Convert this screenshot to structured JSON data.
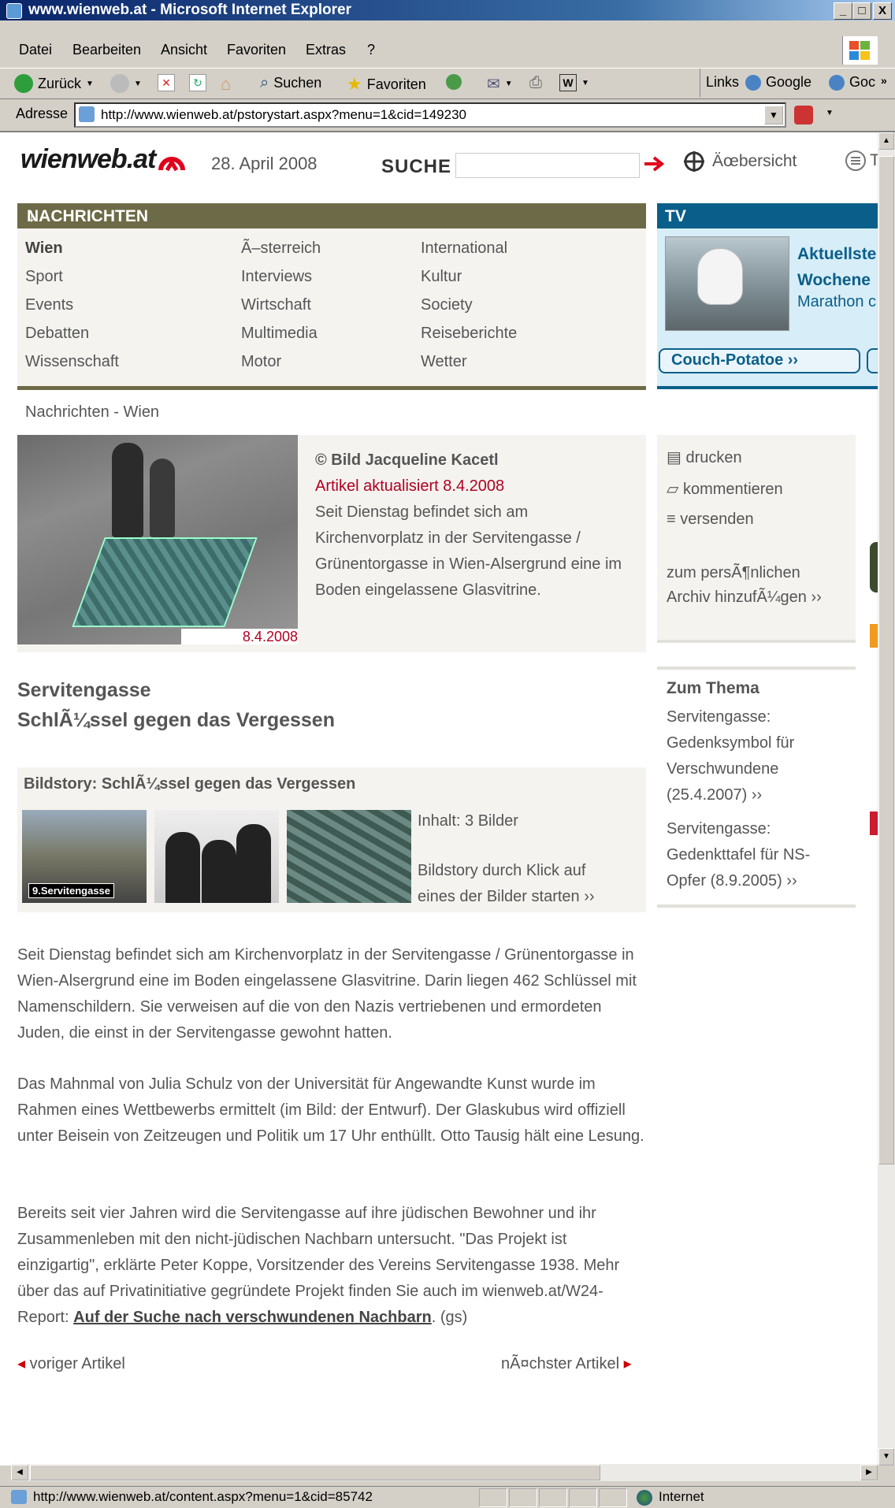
{
  "window": {
    "title": "www.wienweb.at - Microsoft Internet Explorer",
    "min_glyph": "_",
    "max_glyph": "□",
    "close_glyph": "X"
  },
  "menu": [
    "Datei",
    "Bearbeiten",
    "Ansicht",
    "Favoriten",
    "Extras",
    "?"
  ],
  "toolbar": {
    "back": "Zurück",
    "search": "Suchen",
    "favorites": "Favoriten",
    "links": "Links",
    "google1": "Google",
    "google2": "Goc"
  },
  "address": {
    "label": "Adresse",
    "url": "http://www.wienweb.at/pstorystart.aspx?menu=1&cid=149230"
  },
  "site": {
    "logo": "wienweb.at",
    "date": "28. April 2008",
    "search_label": "SUCHE",
    "overview": "Äœbersicht",
    "t_link": "T"
  },
  "nachrichten": {
    "header": "NACHRICHTEN",
    "col1": [
      "Wien",
      "Sport",
      "Events",
      "Debatten",
      "Wissenschaft"
    ],
    "col2": [
      "Ã–sterreich",
      "Interviews",
      "Wirtschaft",
      "Multimedia",
      "Motor"
    ],
    "col3": [
      "International",
      "Kultur",
      "Society",
      "Reiseberichte",
      "Wetter"
    ]
  },
  "tv": {
    "header": "TV",
    "title_line1": "Aktuellste",
    "title_line2": "Wochene",
    "subtitle": "Marathon c",
    "button": "Couch-Potatoe ››"
  },
  "breadcrumb": "Nachrichten - Wien",
  "article": {
    "image_date": "8.4.2008",
    "credit": "© Bild Jacqueline Kacetl",
    "updated": "Artikel aktualisiert 8.4.2008",
    "teaser": "Seit Dienstag befindet sich am Kirchenvorplatz in der Servitengasse / Grünentorgasse in Wien-Alsergrund eine im Boden eingelassene Glasvitrine.",
    "headline1": "Servitengasse",
    "headline2": "SchlÃ¼ssel gegen das Vergessen"
  },
  "bildstory": {
    "title": "Bildstory: SchlÃ¼ssel gegen das Vergessen",
    "thumb1_label": "9.Servitengasse",
    "count": "Inhalt: 3 Bilder",
    "hint_line1": "Bildstory durch Klick auf",
    "hint_line2": "eines der Bilder starten ››"
  },
  "body": {
    "p1": "Seit Dienstag befindet sich am Kirchenvorplatz in der Servitengasse / Grünentorgasse in Wien-Alsergrund eine im Boden eingelassene Glasvitrine. Darin liegen 462 Schlüssel mit Namenschildern. Sie verweisen auf die von den Nazis vertriebenen und ermordeten Juden, die einst in der Servitengasse gewohnt hatten.",
    "p2": "Das Mahnmal von Julia Schulz von der Universität für Angewandte Kunst wurde im Rahmen eines Wettbewerbs ermittelt (im Bild: der Entwurf). Der Glaskubus wird offiziell unter Beisein von Zeitzeugen und Politik um 17 Uhr enthüllt. Otto Tausig hält eine Lesung.",
    "p3_text": "Bereits seit vier Jahren wird die Servitengasse auf ihre jüdischen Bewohner und ihr Zusammenleben mit den nicht-jüdischen Nachbarn untersucht. \"Das Projekt ist einzigartig\", erklärte Peter Koppe, Vorsitzender des Vereins Servitengasse 1938. Mehr über das auf Privatinitiative gegründete Projekt finden Sie auch im wienweb.at/W24-Report: ",
    "p3_link": "Auf der Suche nach verschwundenen Nachbarn",
    "p3_end": ". (gs)"
  },
  "pager": {
    "prev": "voriger Artikel",
    "next": "nÃ¤chster Artikel"
  },
  "tools": {
    "print": "drucken",
    "comment": "kommentieren",
    "send": "versenden",
    "archive_line1": "zum persÃ¶nlichen",
    "archive_line2": "Archiv hinzufÃ¼gen ››"
  },
  "zum_thema": {
    "title": "Zum Thema",
    "item1": "Servitengasse: Gedenksymbol für Verschwundene (25.4.2007) ››",
    "item2": "Servitengasse: Gedenkttafel für NS-Opfer (8.9.2005) ››"
  },
  "status": {
    "url": "http://www.wienweb.at/content.aspx?menu=1&cid=85742",
    "zone": "Internet"
  },
  "colors": {
    "titlebar": "#0a246a",
    "nav_header": "#6d6a47",
    "tv_header": "#0a5f8a",
    "accent_red": "#b00020"
  }
}
